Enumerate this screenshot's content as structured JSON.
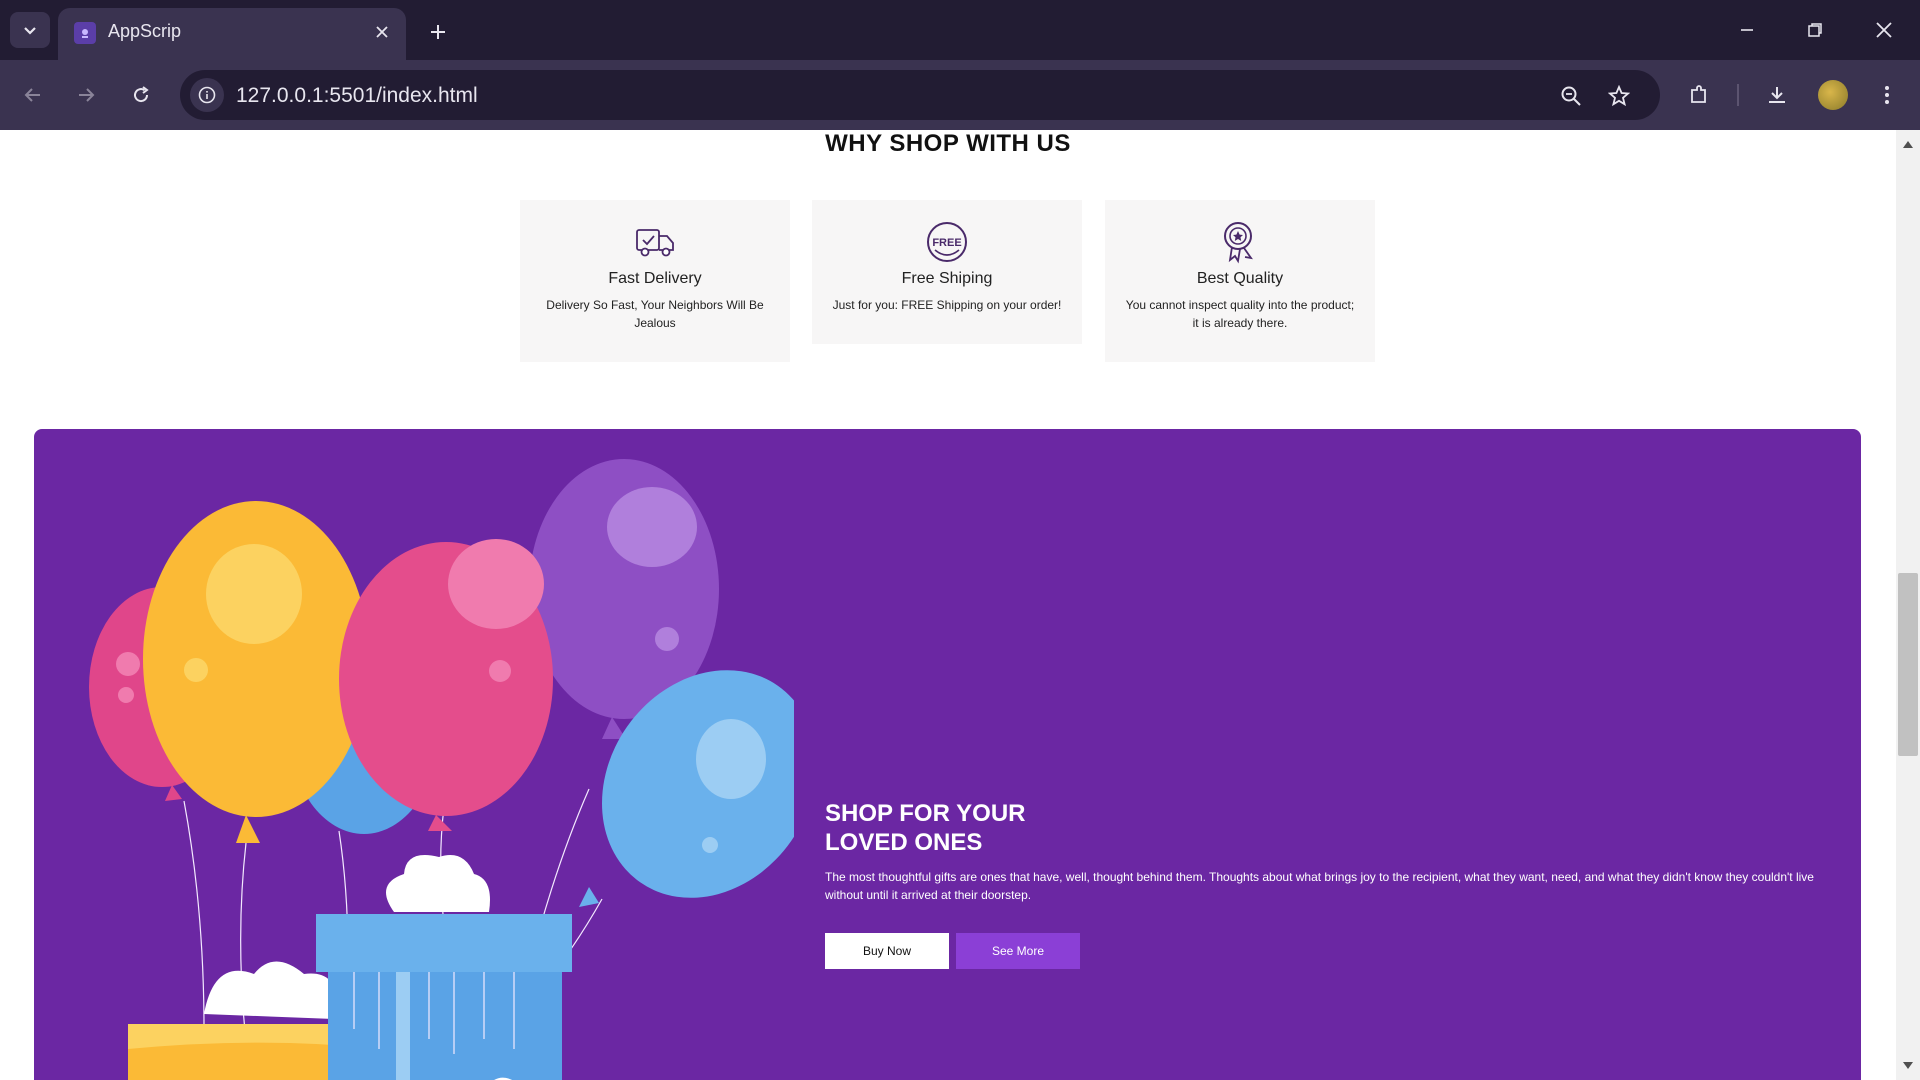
{
  "browser": {
    "tab_title": "AppScrip",
    "url": "127.0.0.1:5501/index.html",
    "icons": [
      "tab-list-icon",
      "close-icon",
      "plus-icon",
      "minimize-icon",
      "restore-icon",
      "back-icon",
      "forward-icon",
      "reload-icon",
      "info-icon",
      "zoom-icon",
      "star-icon",
      "extensions-icon",
      "download-icon",
      "menu-icon"
    ]
  },
  "why_shop": {
    "title": "WHY SHOP WITH US",
    "cards": [
      {
        "icon": "delivery-truck-icon",
        "title": "Fast Delivery",
        "desc": "Delivery So Fast, Your Neighbors Will Be Jealous"
      },
      {
        "icon": "free-shipping-icon",
        "icon_text": "FREE",
        "title": "Free Shiping",
        "desc": "Just for you: FREE Shipping on your order!"
      },
      {
        "icon": "quality-badge-icon",
        "title": "Best Quality",
        "desc": "You cannot inspect quality into the product; it is already there."
      }
    ]
  },
  "banner": {
    "title": "SHOP FOR YOUR LOVED ONES",
    "desc": "The most thoughtful gifts are ones that have, well, thought behind them. Thoughts about what brings joy to the recipient, what they want, need, and what they didn't know they couldn't live without until it arrived at their doorstep.",
    "buy_label": "Buy Now",
    "more_label": "See More",
    "bg_color": "#6b27a3",
    "accent_color": "#8b3fd6"
  }
}
